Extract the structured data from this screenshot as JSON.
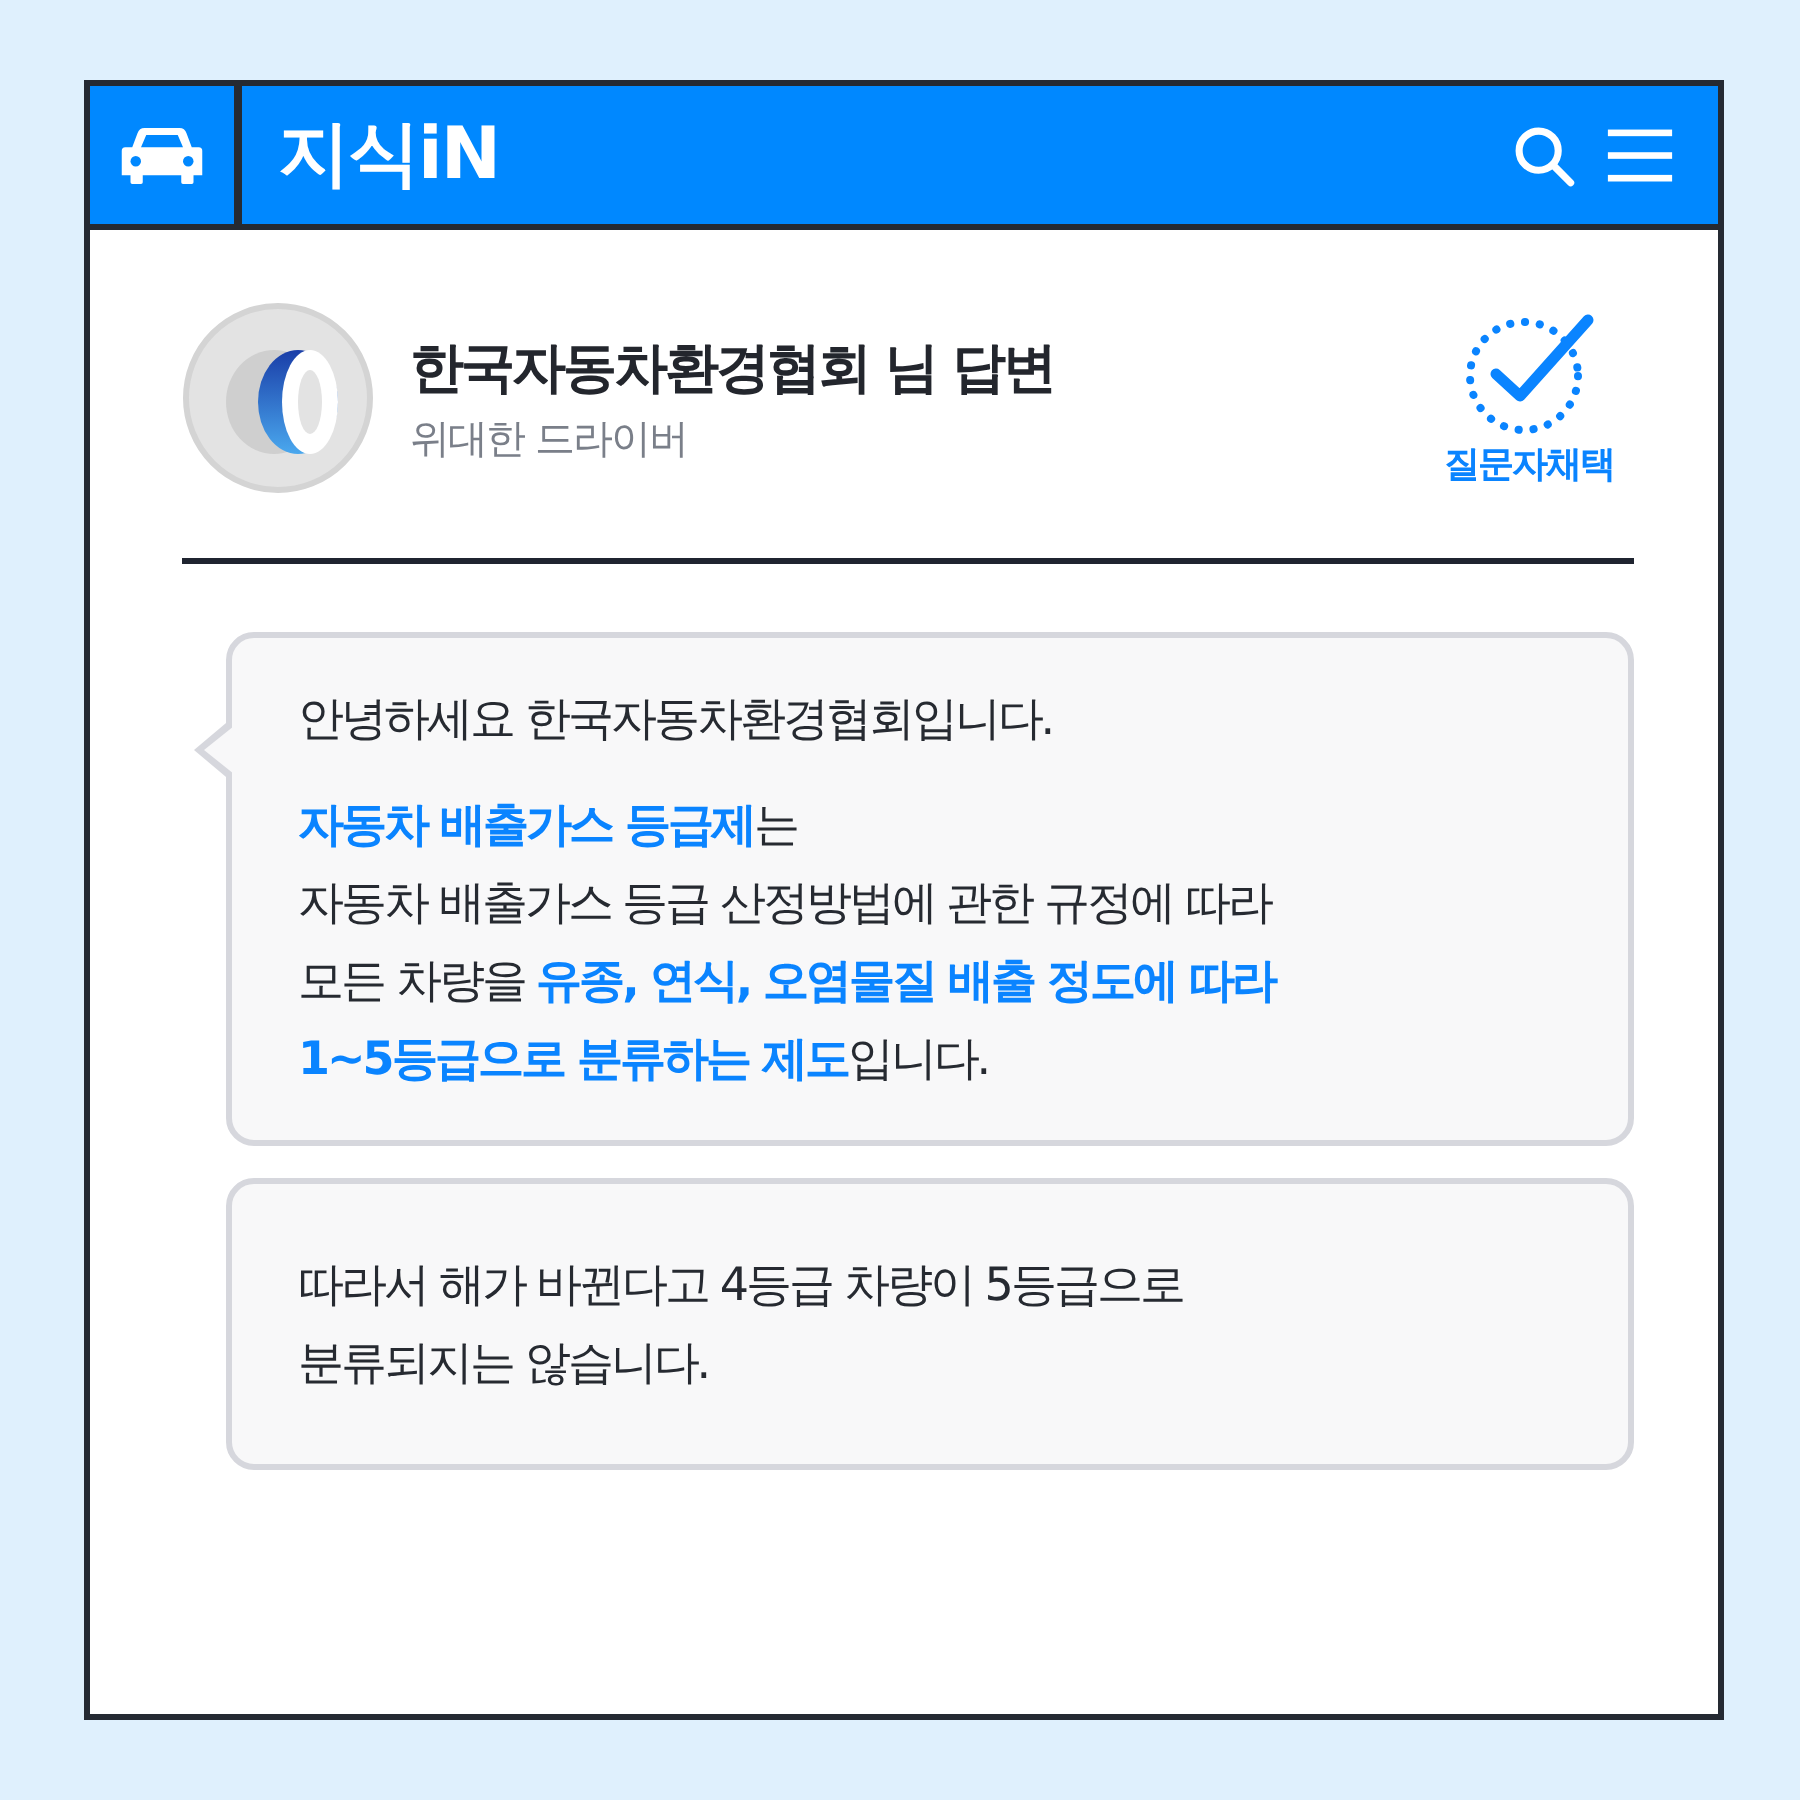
{
  "header": {
    "title": "지식iN"
  },
  "answer": {
    "author": "한국자동차환경협회 님 답변",
    "rank": "위대한 드라이버",
    "badge": "질문자채택"
  },
  "bubbles": [
    {
      "paragraphs": [
        [
          "안녕하세요 한국자동차환경협회입니다."
        ],
        [
          "**자동차 배출가스 등급제**는",
          "자동차 배출가스 등급 산정방법에 관한 규정에 따라",
          "모든 차량을 **유종, 연식, 오염물질 배출 정도에 따라**",
          "**1~5등급으로 분류하는 제도**입니다."
        ]
      ],
      "tail": true
    },
    {
      "paragraphs": [
        [
          "따라서 해가 바뀐다고 4등급 차량이 5등급으로",
          "분류되지는 않습니다."
        ]
      ],
      "tail": false
    }
  ]
}
